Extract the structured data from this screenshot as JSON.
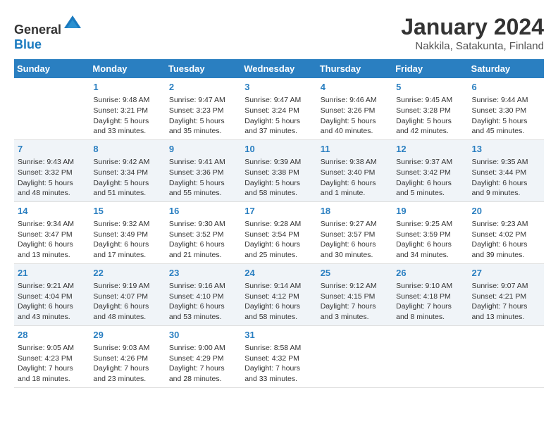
{
  "header": {
    "logo_general": "General",
    "logo_blue": "Blue",
    "title": "January 2024",
    "subtitle": "Nakkila, Satakunta, Finland"
  },
  "calendar": {
    "days_of_week": [
      "Sunday",
      "Monday",
      "Tuesday",
      "Wednesday",
      "Thursday",
      "Friday",
      "Saturday"
    ],
    "weeks": [
      [
        {
          "day": "",
          "info": ""
        },
        {
          "day": "1",
          "info": "Sunrise: 9:48 AM\nSunset: 3:21 PM\nDaylight: 5 hours\nand 33 minutes."
        },
        {
          "day": "2",
          "info": "Sunrise: 9:47 AM\nSunset: 3:23 PM\nDaylight: 5 hours\nand 35 minutes."
        },
        {
          "day": "3",
          "info": "Sunrise: 9:47 AM\nSunset: 3:24 PM\nDaylight: 5 hours\nand 37 minutes."
        },
        {
          "day": "4",
          "info": "Sunrise: 9:46 AM\nSunset: 3:26 PM\nDaylight: 5 hours\nand 40 minutes."
        },
        {
          "day": "5",
          "info": "Sunrise: 9:45 AM\nSunset: 3:28 PM\nDaylight: 5 hours\nand 42 minutes."
        },
        {
          "day": "6",
          "info": "Sunrise: 9:44 AM\nSunset: 3:30 PM\nDaylight: 5 hours\nand 45 minutes."
        }
      ],
      [
        {
          "day": "7",
          "info": "Sunrise: 9:43 AM\nSunset: 3:32 PM\nDaylight: 5 hours\nand 48 minutes."
        },
        {
          "day": "8",
          "info": "Sunrise: 9:42 AM\nSunset: 3:34 PM\nDaylight: 5 hours\nand 51 minutes."
        },
        {
          "day": "9",
          "info": "Sunrise: 9:41 AM\nSunset: 3:36 PM\nDaylight: 5 hours\nand 55 minutes."
        },
        {
          "day": "10",
          "info": "Sunrise: 9:39 AM\nSunset: 3:38 PM\nDaylight: 5 hours\nand 58 minutes."
        },
        {
          "day": "11",
          "info": "Sunrise: 9:38 AM\nSunset: 3:40 PM\nDaylight: 6 hours\nand 1 minute."
        },
        {
          "day": "12",
          "info": "Sunrise: 9:37 AM\nSunset: 3:42 PM\nDaylight: 6 hours\nand 5 minutes."
        },
        {
          "day": "13",
          "info": "Sunrise: 9:35 AM\nSunset: 3:44 PM\nDaylight: 6 hours\nand 9 minutes."
        }
      ],
      [
        {
          "day": "14",
          "info": "Sunrise: 9:34 AM\nSunset: 3:47 PM\nDaylight: 6 hours\nand 13 minutes."
        },
        {
          "day": "15",
          "info": "Sunrise: 9:32 AM\nSunset: 3:49 PM\nDaylight: 6 hours\nand 17 minutes."
        },
        {
          "day": "16",
          "info": "Sunrise: 9:30 AM\nSunset: 3:52 PM\nDaylight: 6 hours\nand 21 minutes."
        },
        {
          "day": "17",
          "info": "Sunrise: 9:28 AM\nSunset: 3:54 PM\nDaylight: 6 hours\nand 25 minutes."
        },
        {
          "day": "18",
          "info": "Sunrise: 9:27 AM\nSunset: 3:57 PM\nDaylight: 6 hours\nand 30 minutes."
        },
        {
          "day": "19",
          "info": "Sunrise: 9:25 AM\nSunset: 3:59 PM\nDaylight: 6 hours\nand 34 minutes."
        },
        {
          "day": "20",
          "info": "Sunrise: 9:23 AM\nSunset: 4:02 PM\nDaylight: 6 hours\nand 39 minutes."
        }
      ],
      [
        {
          "day": "21",
          "info": "Sunrise: 9:21 AM\nSunset: 4:04 PM\nDaylight: 6 hours\nand 43 minutes."
        },
        {
          "day": "22",
          "info": "Sunrise: 9:19 AM\nSunset: 4:07 PM\nDaylight: 6 hours\nand 48 minutes."
        },
        {
          "day": "23",
          "info": "Sunrise: 9:16 AM\nSunset: 4:10 PM\nDaylight: 6 hours\nand 53 minutes."
        },
        {
          "day": "24",
          "info": "Sunrise: 9:14 AM\nSunset: 4:12 PM\nDaylight: 6 hours\nand 58 minutes."
        },
        {
          "day": "25",
          "info": "Sunrise: 9:12 AM\nSunset: 4:15 PM\nDaylight: 7 hours\nand 3 minutes."
        },
        {
          "day": "26",
          "info": "Sunrise: 9:10 AM\nSunset: 4:18 PM\nDaylight: 7 hours\nand 8 minutes."
        },
        {
          "day": "27",
          "info": "Sunrise: 9:07 AM\nSunset: 4:21 PM\nDaylight: 7 hours\nand 13 minutes."
        }
      ],
      [
        {
          "day": "28",
          "info": "Sunrise: 9:05 AM\nSunset: 4:23 PM\nDaylight: 7 hours\nand 18 minutes."
        },
        {
          "day": "29",
          "info": "Sunrise: 9:03 AM\nSunset: 4:26 PM\nDaylight: 7 hours\nand 23 minutes."
        },
        {
          "day": "30",
          "info": "Sunrise: 9:00 AM\nSunset: 4:29 PM\nDaylight: 7 hours\nand 28 minutes."
        },
        {
          "day": "31",
          "info": "Sunrise: 8:58 AM\nSunset: 4:32 PM\nDaylight: 7 hours\nand 33 minutes."
        },
        {
          "day": "",
          "info": ""
        },
        {
          "day": "",
          "info": ""
        },
        {
          "day": "",
          "info": ""
        }
      ]
    ]
  }
}
